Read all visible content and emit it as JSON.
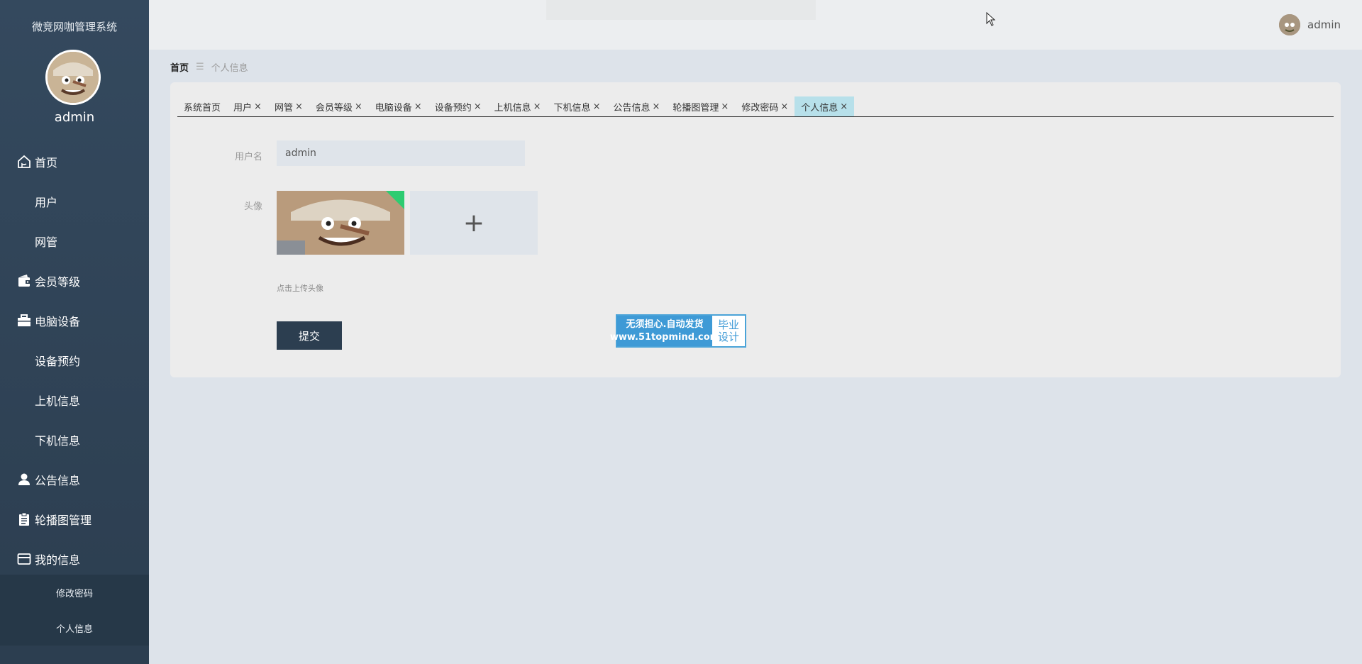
{
  "sidebar": {
    "system_title": "微竞网咖管理系统",
    "username": "admin",
    "items": [
      {
        "label": "首页",
        "icon": "home-icon"
      },
      {
        "label": "用户",
        "icon": "grid-icon"
      },
      {
        "label": "网管",
        "icon": "grid-icon"
      },
      {
        "label": "会员等级",
        "icon": "wallet-icon"
      },
      {
        "label": "电脑设备",
        "icon": "briefcase-icon"
      },
      {
        "label": "设备预约",
        "icon": "grid-icon"
      },
      {
        "label": "上机信息",
        "icon": "grid-icon"
      },
      {
        "label": "下机信息",
        "icon": "grid-icon"
      },
      {
        "label": "公告信息",
        "icon": "user-icon"
      },
      {
        "label": "轮播图管理",
        "icon": "clipboard-icon"
      },
      {
        "label": "我的信息",
        "icon": "card-icon"
      }
    ],
    "subitems": [
      {
        "label": "修改密码"
      },
      {
        "label": "个人信息"
      }
    ]
  },
  "header": {
    "username": "admin"
  },
  "breadcrumb": {
    "home": "首页",
    "separator": "☰",
    "current": "个人信息"
  },
  "tabs": [
    {
      "label": "系统首页",
      "closable": false
    },
    {
      "label": "用户",
      "closable": true
    },
    {
      "label": "网管",
      "closable": true
    },
    {
      "label": "会员等级",
      "closable": true
    },
    {
      "label": "电脑设备",
      "closable": true
    },
    {
      "label": "设备预约",
      "closable": true
    },
    {
      "label": "上机信息",
      "closable": true
    },
    {
      "label": "下机信息",
      "closable": true
    },
    {
      "label": "公告信息",
      "closable": true
    },
    {
      "label": "轮播图管理",
      "closable": true
    },
    {
      "label": "修改密码",
      "closable": true
    },
    {
      "label": "个人信息",
      "closable": true,
      "active": true
    }
  ],
  "form": {
    "username_label": "用户名",
    "username_value": "admin",
    "avatar_label": "头像",
    "upload_plus": "+",
    "upload_hint": "点击上传头像",
    "submit_label": "提交"
  },
  "watermark": {
    "line1": "无须担心.自动发货",
    "line2": "www.51topmind.com",
    "right1": "毕业",
    "right2": "设计"
  },
  "colors": {
    "sidebar": "#2c3e50",
    "active_tab": "#b7e0ea",
    "success_corner": "#2ecc71"
  }
}
